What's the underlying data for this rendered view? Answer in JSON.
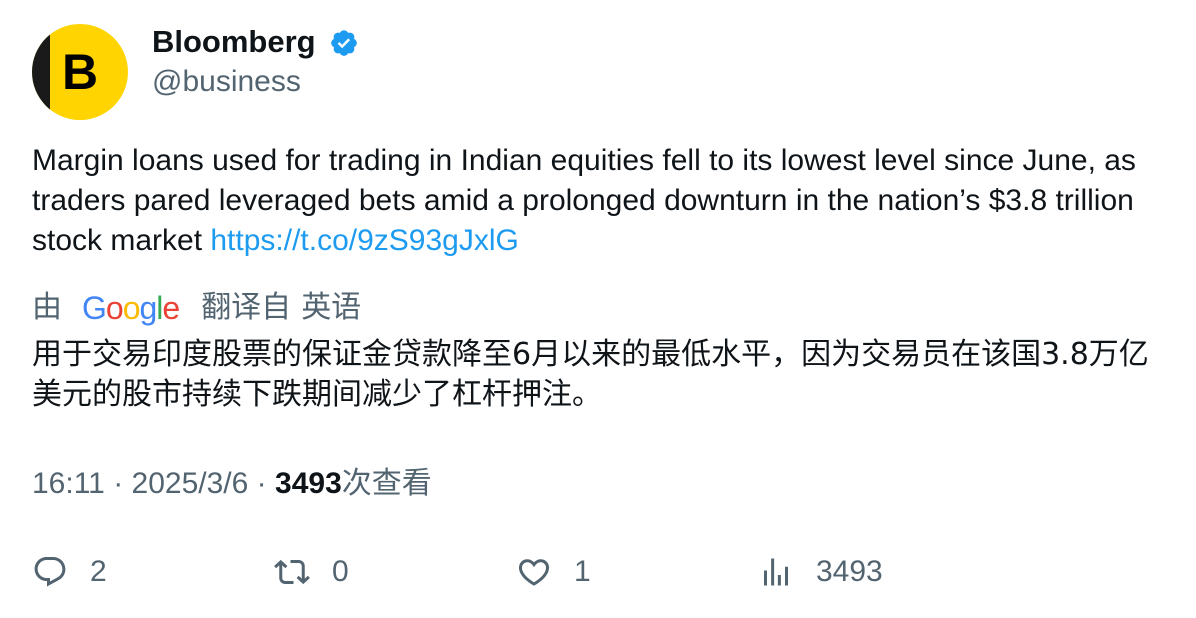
{
  "author": {
    "name": "Bloomberg",
    "handle": "@business",
    "avatar_letter": "B",
    "verified": true
  },
  "tweet": {
    "text": "Margin loans used for trading in Indian equities fell to its lowest level since June, as traders pared leveraged bets amid a prolonged downturn in the nation’s $3.8 trillion stock market ",
    "link": "https://t.co/9zS93gJxlG"
  },
  "translation": {
    "by_label": "由",
    "provider": "Google",
    "translated_from_label": "翻译自",
    "source_language": "英语",
    "text": "用于交易印度股票的保证金贷款降至6月以来的最低水平，因为交易员在该国3.8万亿美元的股市持续下跌期间减少了杠杆押注。"
  },
  "meta": {
    "time": "16:11",
    "separator": "·",
    "date": "2025/3/6",
    "views": "3493",
    "views_label": "次查看"
  },
  "actions": {
    "replies": "2",
    "reposts": "0",
    "likes": "1",
    "views": "3493"
  },
  "colors": {
    "link": "#1d9bf0",
    "secondary_text": "#536471",
    "verified_badge": "#1d9bf0",
    "avatar_bg": "#ffd400"
  },
  "icons": [
    "verified-badge-icon",
    "reply-icon",
    "repost-icon",
    "like-icon",
    "views-icon"
  ]
}
